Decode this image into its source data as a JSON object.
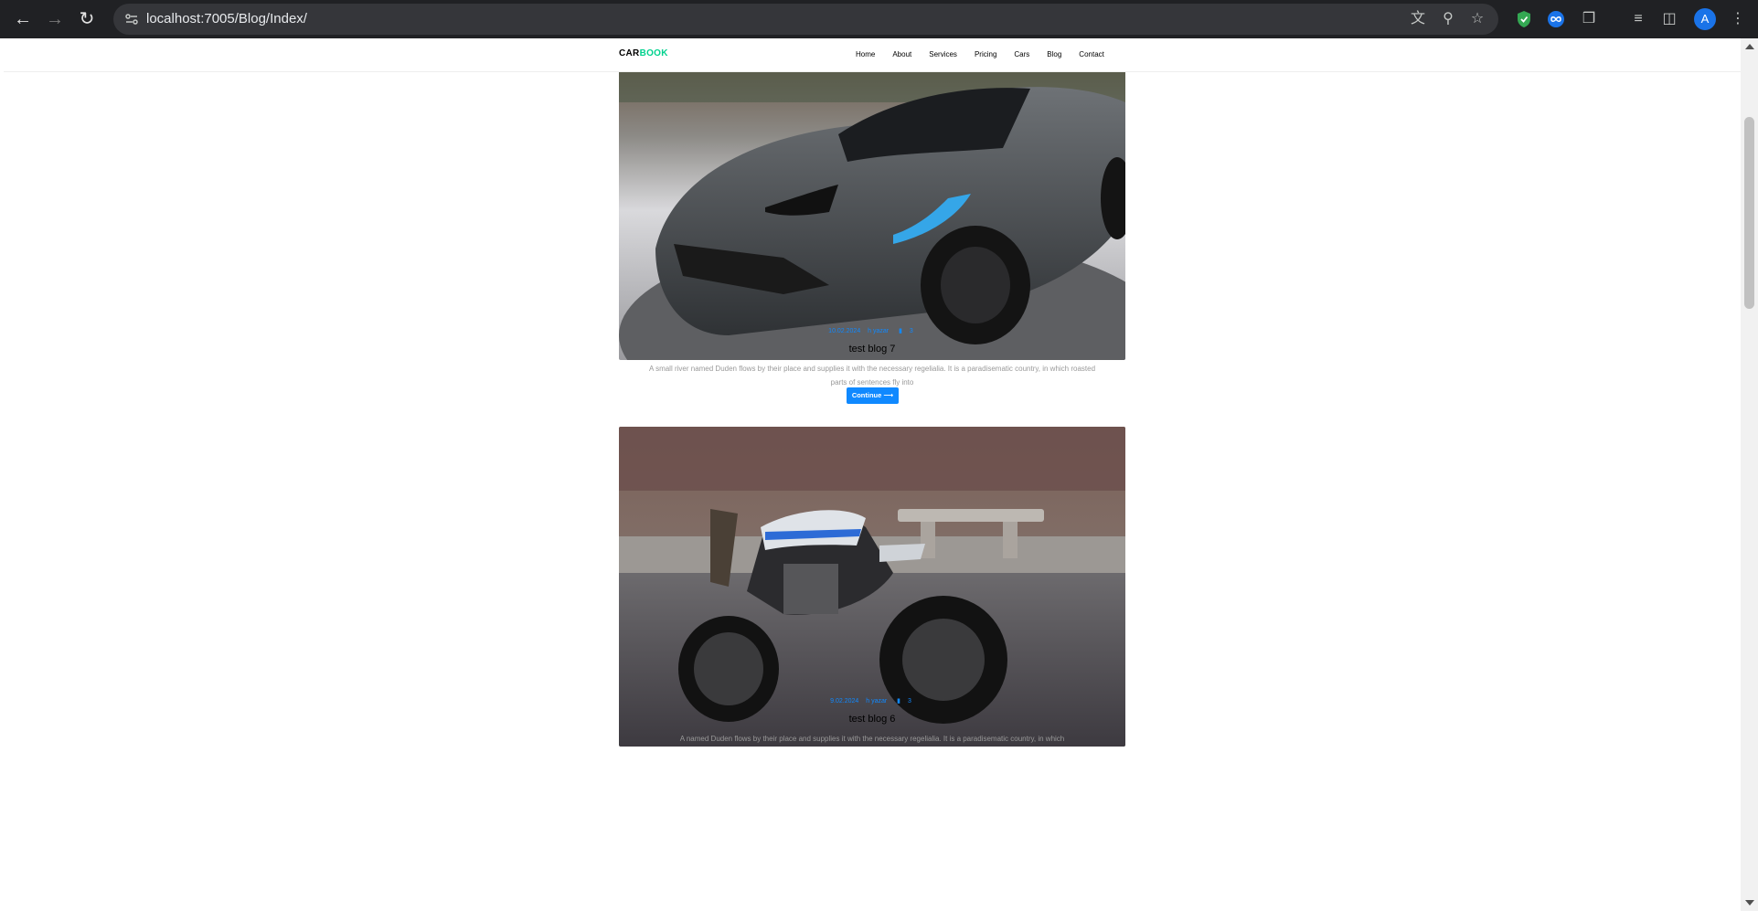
{
  "browser": {
    "url": "localhost:7005/Blog/Index/",
    "profile_initial": "A"
  },
  "site": {
    "brand_part1": "CAR",
    "brand_part2": "BOOK",
    "brand_color": "#01d28e",
    "accent_color": "#1089ff",
    "nav": [
      "Home",
      "About",
      "Services",
      "Pricing",
      "Cars",
      "Blog",
      "Contact"
    ]
  },
  "posts": [
    {
      "date": "10.02.2024",
      "author": "h yazar",
      "comments": "3",
      "title": "test blog 7",
      "excerpt": "A small river named Duden flows by their place and supplies it with the necessary regelialia. It is a paradisematic country, in which roasted parts of sentences fly into",
      "button": "Continue"
    },
    {
      "date": "9.02.2024",
      "author": "h yazar",
      "comments": "3",
      "title": "test blog 6",
      "excerpt": "A named Duden flows by their place and supplies it with the necessary regelialia. It is a paradisematic country, in which"
    }
  ]
}
